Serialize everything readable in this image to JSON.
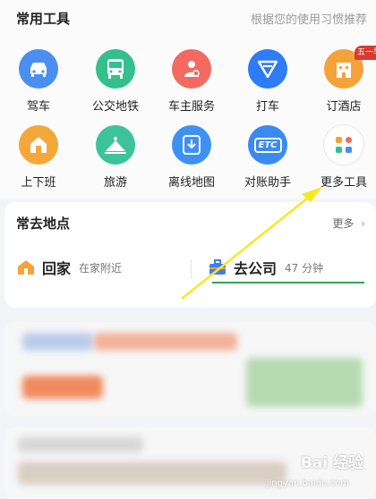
{
  "tools": {
    "title": "常用工具",
    "hint": "根据您的使用习惯推荐",
    "items": [
      {
        "label": "驾车",
        "color": "#4a8ff0",
        "icon": "car-icon"
      },
      {
        "label": "公交地铁",
        "color": "#33c08c",
        "icon": "bus-icon"
      },
      {
        "label": "车主服务",
        "color": "#f46a60",
        "icon": "car-owner-icon"
      },
      {
        "label": "打车",
        "color": "#2e7cf6",
        "icon": "taxi-icon"
      },
      {
        "label": "订酒店",
        "color": "#f5a23a",
        "icon": "hotel-icon",
        "badge": "五一早鸟"
      },
      {
        "label": "上下班",
        "color": "#f6a73a",
        "icon": "commute-icon"
      },
      {
        "label": "旅游",
        "color": "#3cc39a",
        "icon": "travel-icon"
      },
      {
        "label": "离线地图",
        "color": "#3f91f1",
        "icon": "offline-map-icon"
      },
      {
        "label": "对账助手",
        "color": "#3a8af2",
        "icon": "etc-icon",
        "icon_text": "ETC"
      },
      {
        "label": "更多工具",
        "color": "#ffffff",
        "icon": "more-tools-icon"
      }
    ]
  },
  "places": {
    "title": "常去地点",
    "more": "更多",
    "home": {
      "name": "回家",
      "sub": "在家附近"
    },
    "work": {
      "name": "去公司",
      "sub": "47 分钟"
    }
  },
  "watermark": {
    "brand": "Bai 经验",
    "url": "jingyan.baidu.com"
  }
}
